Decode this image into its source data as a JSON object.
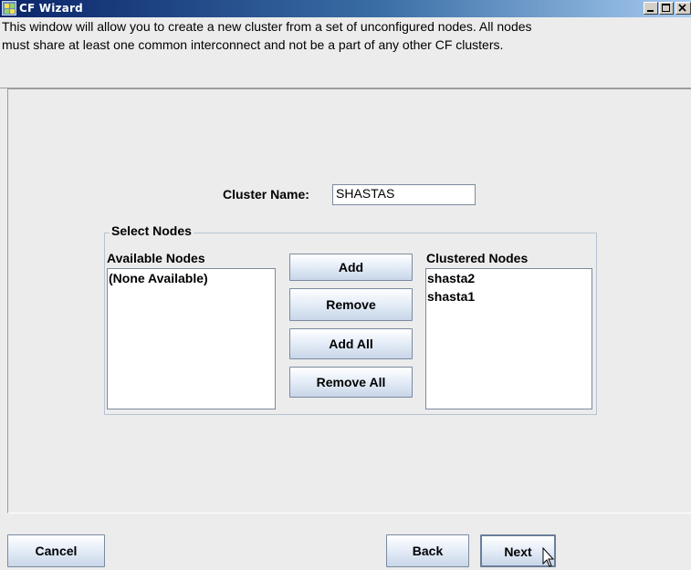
{
  "window": {
    "title": "CF Wizard",
    "controls": [
      "minimize-icon",
      "maximize-icon",
      "close-icon"
    ]
  },
  "intro": {
    "line1": "This window will allow you to create a new cluster from a set of unconfigured nodes.  All nodes",
    "line2": "must share at least one common interconnect and not be a part of any other CF clusters."
  },
  "cluster": {
    "label": "Cluster Name:",
    "value": "SHASTAS"
  },
  "select_nodes": {
    "legend": "Select Nodes",
    "available_title": "Available Nodes",
    "available_items": [
      "(None Available)"
    ],
    "clustered_title": "Clustered Nodes",
    "clustered_items": [
      "shasta2",
      "shasta1"
    ],
    "buttons": {
      "add": "Add",
      "remove": "Remove",
      "add_all": "Add All",
      "remove_all": "Remove All"
    }
  },
  "footer": {
    "cancel": "Cancel",
    "back": "Back",
    "next": "Next"
  },
  "colors": {
    "title_start": "#0a246a",
    "title_end": "#a6caf0",
    "background": "#ececec",
    "button_top": "#ffffff",
    "button_bottom": "#c8d6e8"
  }
}
